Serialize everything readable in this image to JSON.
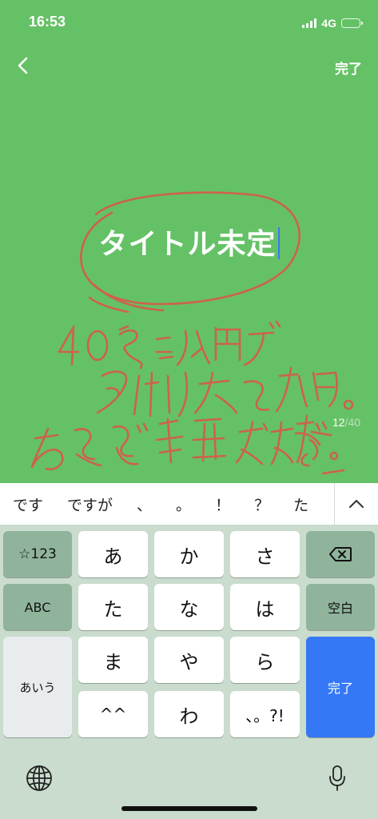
{
  "status_bar": {
    "time": "16:53",
    "network": "4G",
    "battery_level": 0.55
  },
  "header": {
    "back_icon": "chevron-left-icon",
    "done_label": "完了"
  },
  "editor": {
    "background_color": "#65c166",
    "title_text": "タイトル未定",
    "char_count": "12",
    "char_separator": "/",
    "char_limit": "40"
  },
  "suggestions": {
    "items": [
      "です",
      "ですが",
      "、",
      "。",
      "！",
      "？",
      "た"
    ],
    "expand_icon": "chevron-up-icon"
  },
  "keyboard": {
    "row1": {
      "left": "☆123",
      "keys": [
        "あ",
        "か",
        "さ"
      ],
      "right_icon": "backspace-icon"
    },
    "row2": {
      "left": "ABC",
      "keys": [
        "た",
        "な",
        "は"
      ],
      "right": "空白"
    },
    "row3": {
      "keys": [
        "ま",
        "や",
        "ら"
      ]
    },
    "row4": {
      "keys": [
        "^^",
        "わ",
        "、。?!"
      ]
    },
    "mode_key": "あいう",
    "enter_label": "完了",
    "globe_icon": "globe-icon",
    "mic_icon": "microphone-icon",
    "action_color": "#3478f6"
  }
}
